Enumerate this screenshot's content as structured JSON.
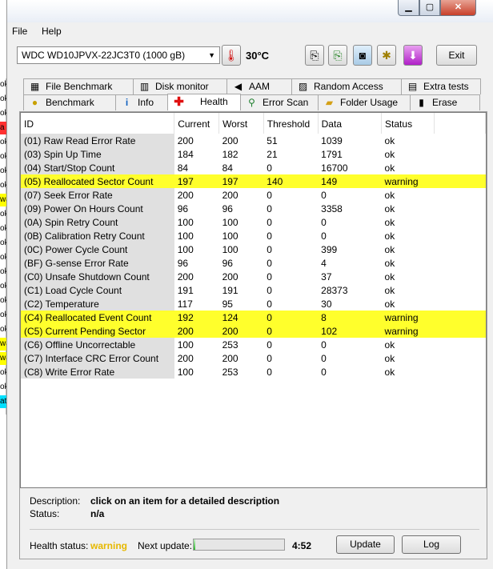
{
  "menu": {
    "file": "File",
    "help": "Help"
  },
  "toolbar": {
    "drive": "WDC     WD10JPVX-22JC3T0 (1000 gB)",
    "temperature": "30°C",
    "exit": "Exit"
  },
  "tabs_row1": [
    {
      "label": "File Benchmark",
      "icon": "file-benchmark-icon"
    },
    {
      "label": "Disk monitor",
      "icon": "disk-monitor-icon"
    },
    {
      "label": "AAM",
      "icon": "speaker-icon"
    },
    {
      "label": "Random Access",
      "icon": "random-access-icon"
    },
    {
      "label": "Extra tests",
      "icon": "extra-tests-icon"
    }
  ],
  "tabs_row2": [
    {
      "label": "Benchmark",
      "icon": "benchmark-icon"
    },
    {
      "label": "Info",
      "icon": "info-icon"
    },
    {
      "label": "Health",
      "icon": "health-cross-icon"
    },
    {
      "label": "Error Scan",
      "icon": "magnifier-icon"
    },
    {
      "label": "Folder Usage",
      "icon": "folder-icon"
    },
    {
      "label": "Erase",
      "icon": "trash-icon"
    }
  ],
  "columns": [
    "ID",
    "Current",
    "Worst",
    "Threshold",
    "Data",
    "Status"
  ],
  "rows": [
    [
      "(01) Raw Read Error Rate",
      "200",
      "200",
      "51",
      "1039",
      "ok"
    ],
    [
      "(03) Spin Up Time",
      "184",
      "182",
      "21",
      "1791",
      "ok"
    ],
    [
      "(04) Start/Stop Count",
      "84",
      "84",
      "0",
      "16700",
      "ok"
    ],
    [
      "(05) Reallocated Sector Count",
      "197",
      "197",
      "140",
      "149",
      "warning"
    ],
    [
      "(07) Seek Error Rate",
      "200",
      "200",
      "0",
      "0",
      "ok"
    ],
    [
      "(09) Power On Hours Count",
      "96",
      "96",
      "0",
      "3358",
      "ok"
    ],
    [
      "(0A) Spin Retry Count",
      "100",
      "100",
      "0",
      "0",
      "ok"
    ],
    [
      "(0B) Calibration Retry Count",
      "100",
      "100",
      "0",
      "0",
      "ok"
    ],
    [
      "(0C) Power Cycle Count",
      "100",
      "100",
      "0",
      "399",
      "ok"
    ],
    [
      "(BF) G-sense Error Rate",
      "96",
      "96",
      "0",
      "4",
      "ok"
    ],
    [
      "(C0) Unsafe Shutdown Count",
      "200",
      "200",
      "0",
      "37",
      "ok"
    ],
    [
      "(C1) Load Cycle Count",
      "191",
      "191",
      "0",
      "28373",
      "ok"
    ],
    [
      "(C2) Temperature",
      "117",
      "95",
      "0",
      "30",
      "ok"
    ],
    [
      "(C4) Reallocated Event Count",
      "192",
      "124",
      "0",
      "8",
      "warning"
    ],
    [
      "(C5) Current Pending Sector",
      "200",
      "200",
      "0",
      "102",
      "warning"
    ],
    [
      "(C6) Offline Uncorrectable",
      "100",
      "253",
      "0",
      "0",
      "ok"
    ],
    [
      "(C7) Interface CRC Error Count",
      "200",
      "200",
      "0",
      "0",
      "ok"
    ],
    [
      "(C8) Write Error Rate",
      "100",
      "253",
      "0",
      "0",
      "ok"
    ]
  ],
  "warning_color": "#ffff2c",
  "description": {
    "label": "Description:",
    "value": "click on an item for a detailed description",
    "status_label": "Status:",
    "status_value": "n/a"
  },
  "footer": {
    "health_label": "Health status:",
    "health_value": "warning",
    "next_label": "Next update:",
    "next_value": "4:52",
    "progress": 0.02,
    "update": "Update",
    "log": "Log"
  },
  "background_strip": [
    "ok",
    "ok",
    "ok",
    "a",
    "ok",
    "ok",
    "ok",
    "ok",
    "wa",
    "ok",
    "ok",
    "ok",
    "ok",
    "ok",
    "ok",
    "ok",
    "ok",
    "ok",
    "wa",
    "wa",
    "ok",
    "ok",
    "att"
  ]
}
